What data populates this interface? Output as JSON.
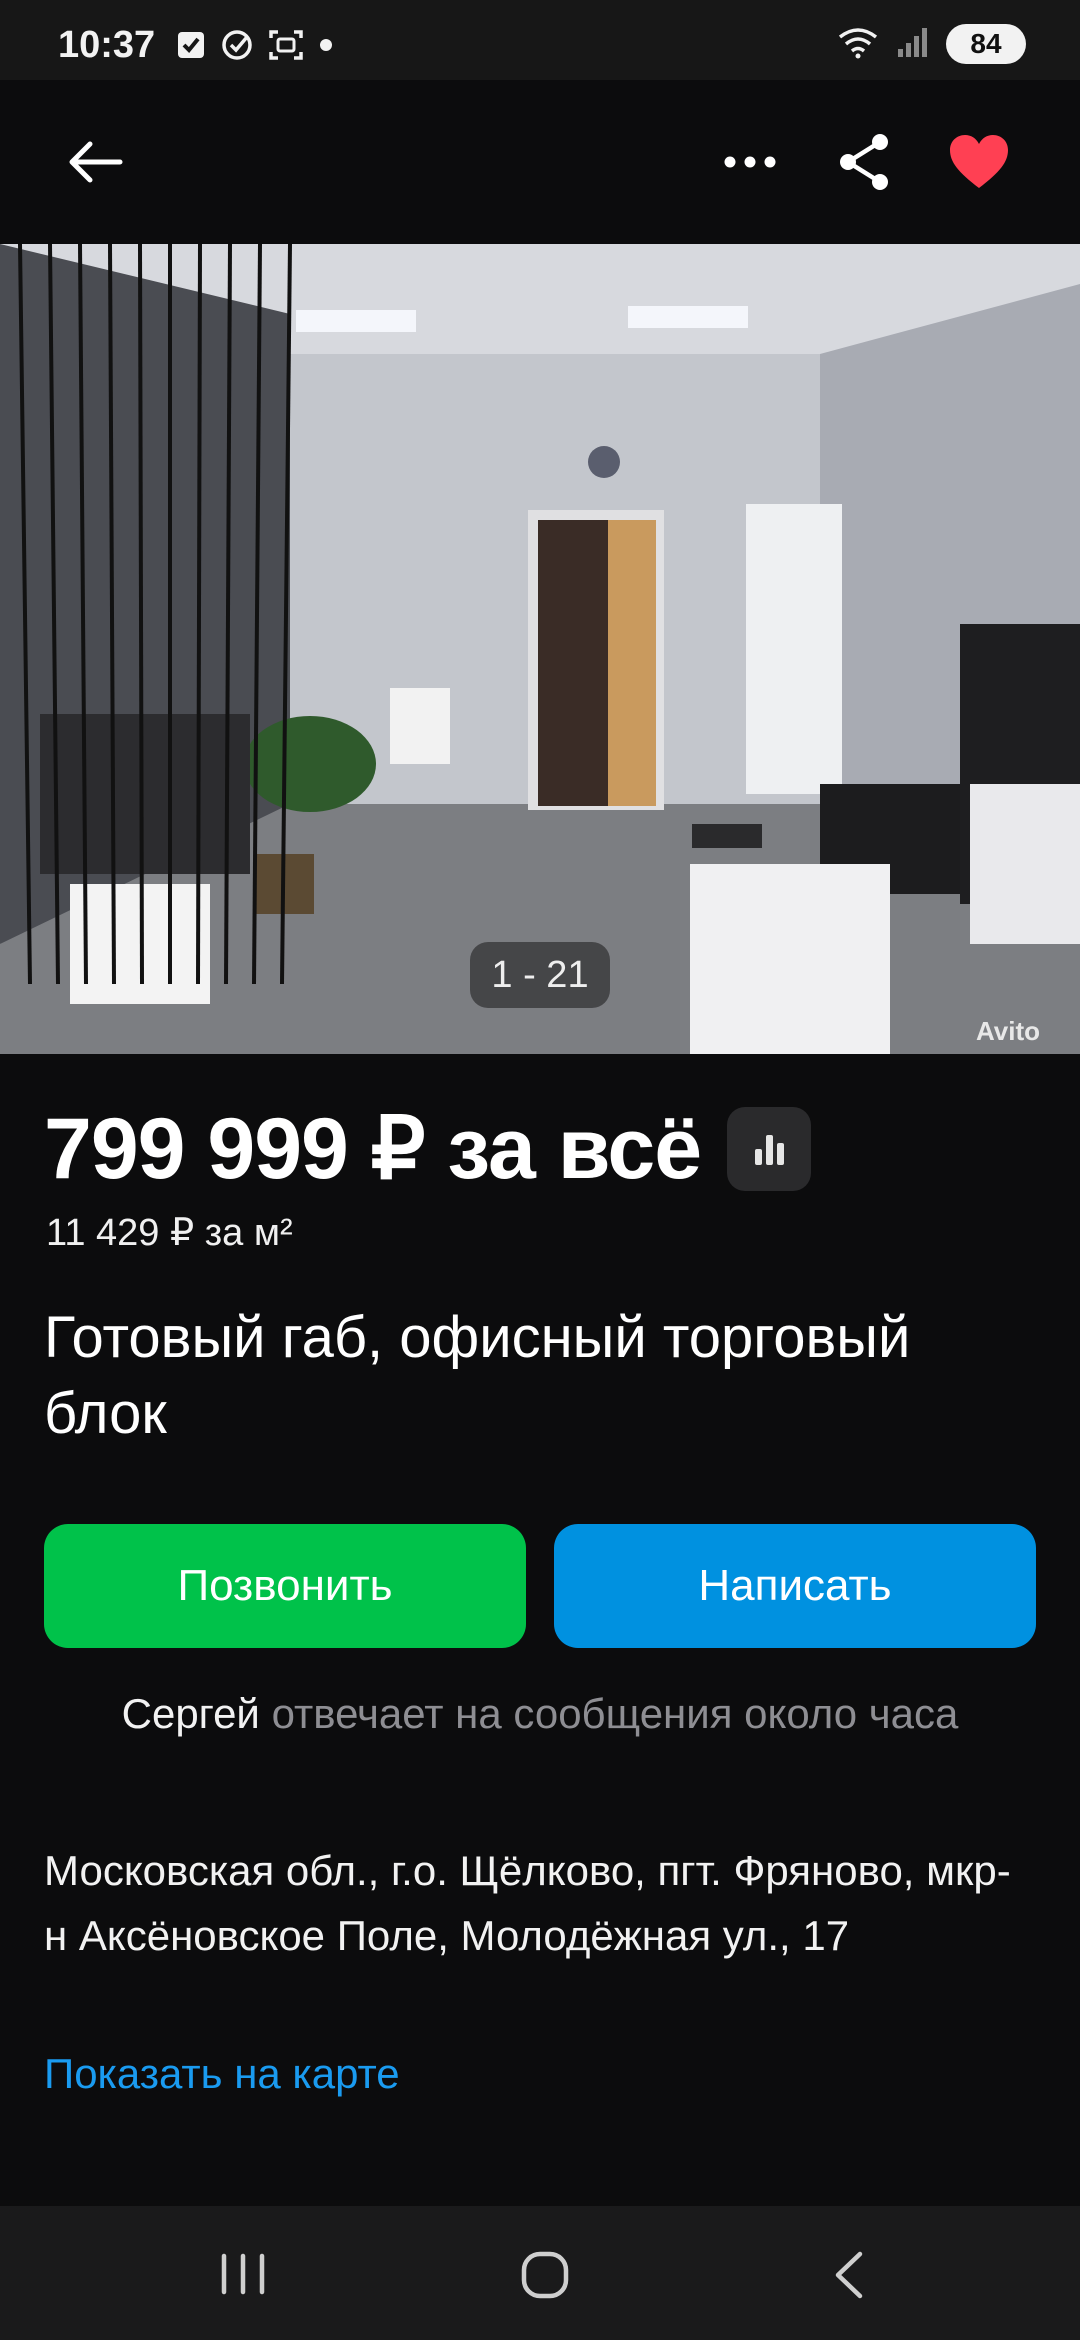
{
  "status_bar": {
    "time": "10:37",
    "battery": "84",
    "left_icons": [
      "checkbox-icon",
      "check-circle-icon",
      "screenshot-icon",
      "dot-icon"
    ],
    "right_icons": [
      "wifi-icon",
      "signal-icon",
      "battery-icon"
    ]
  },
  "app_bar": {
    "icons": [
      "back-arrow-icon",
      "more-icon",
      "share-icon",
      "heart-icon"
    ],
    "accent_favorite": "#ff4053"
  },
  "photo": {
    "counter": "1 - 21",
    "watermark": "Avito"
  },
  "listing": {
    "price": "799 999 ₽ за всё",
    "price_per_m2": "11 429 ₽ за м²",
    "title": "Готовый габ, офисный торговый блок"
  },
  "actions": {
    "call_label": "Позвонить",
    "write_label": "Написать",
    "call_color": "#00c24a",
    "write_color": "#0091e0"
  },
  "seller": {
    "name": "Сергей",
    "response_note": "отвечает на сообщения около часа"
  },
  "location": {
    "address": "Московская обл., г.о. Щёлково, пгт. Фряново, мкр-н Аксёновское Поле, Молодёжная ул., 17",
    "map_link": "Показать на карте"
  },
  "nav_bar": {
    "icons": [
      "recents-icon",
      "home-icon",
      "back-icon"
    ]
  }
}
